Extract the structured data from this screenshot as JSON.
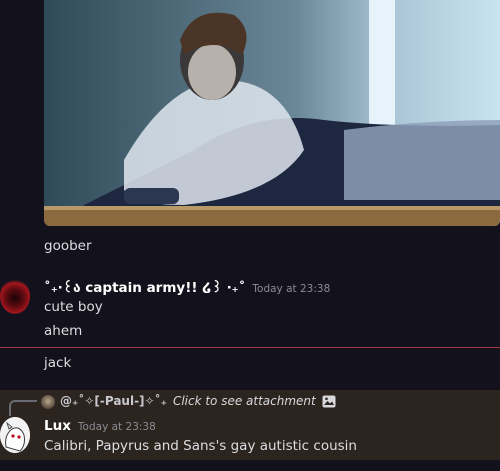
{
  "attachment_message": {
    "text": "goober"
  },
  "captain_message": {
    "username": "˚₊‧꒰ა captain army!! ໒꒱ ‧₊˚",
    "timestamp": "Today at 23:38",
    "lines": [
      "cute boy",
      "ahem"
    ]
  },
  "jack_message": {
    "text": "jack"
  },
  "reply_message": {
    "reply_to": {
      "author": "@₊˚✧[-Paul-]✧˚₊",
      "preview": "Click to see attachment"
    },
    "username": "Lux",
    "timestamp": "Today at 23:38",
    "text": "Calibri, Papyrus and Sans's gay autistic cousin"
  },
  "colors": {
    "background": "#13121c",
    "reply_highlight": "#2b241f",
    "new_divider": "#a6393f",
    "username": "#ffffff",
    "timestamp": "#8a8b92"
  }
}
